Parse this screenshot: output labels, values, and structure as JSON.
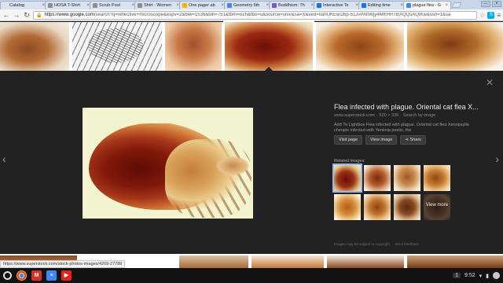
{
  "browser": {
    "tabs": [
      {
        "label": "Catalog",
        "favicon_color": "#e3e3e3",
        "active": false
      },
      {
        "label": "HOSA T-Shirt",
        "favicon_color": "#8e8e8e",
        "active": false
      },
      {
        "label": "Scrub Pool",
        "favicon_color": "#8e8e8e",
        "active": false
      },
      {
        "label": "Shirt - Women",
        "favicon_color": "#8e8e8e",
        "active": false
      },
      {
        "label": "One pager ab",
        "favicon_color": "#f4b400",
        "active": false
      },
      {
        "label": "Geometry 6th",
        "favicon_color": "#4285f4",
        "active": false
      },
      {
        "label": "Buddhism: Th",
        "favicon_color": "#7e57c2",
        "active": false
      },
      {
        "label": "Interactive Te",
        "favicon_color": "#1a73e8",
        "active": false
      },
      {
        "label": "Editing time",
        "favicon_color": "#1a73e8",
        "active": false
      },
      {
        "label": "plague flea - G",
        "favicon_color": "#4285f4",
        "active": true
      }
    ],
    "tab_close_glyph": "×",
    "url_host": "https://www.google.com",
    "url_path": "/search?q=reflective+microscope&espv=2&biw=1536&bih=751&tbm=isch&tbo=u&source=univ&sa=X&ved=0ahUKEwi26p-51JvPAhWjy4MKHRTBXQQsAQIKw&ssrl=1&sa",
    "back_glyph": "←",
    "forward_glyph": "→",
    "reload_glyph": "↻",
    "star_glyph": "☆",
    "menu_glyph": "≡",
    "ext_skype_color": "#00aff0"
  },
  "preview": {
    "title": "Flea infected with plague. Oriental cat flea X...",
    "source": "www.superstock.com",
    "size": "520 × 339",
    "search_by_image": "Search by image",
    "description": "Add To Lightbox Flea infected with plague. Oriental cat flea Xenopsylla cheopis infected with Yersinia pestis, the",
    "buttons": {
      "visit": "Visit page",
      "view": "View image",
      "share": "Share"
    },
    "related_label": "Related images:",
    "view_more": "View more",
    "footnote_left": "Images may be subject to copyright.",
    "footnote_right": "Send feedback",
    "close_glyph": "✕",
    "prev_glyph": "‹",
    "next_glyph": "›"
  },
  "status_bar": {
    "url": "https://www.superstock.com/stock-photos-images/4269-27789"
  },
  "shelf": {
    "notification_count": "1",
    "time": "9:52"
  }
}
